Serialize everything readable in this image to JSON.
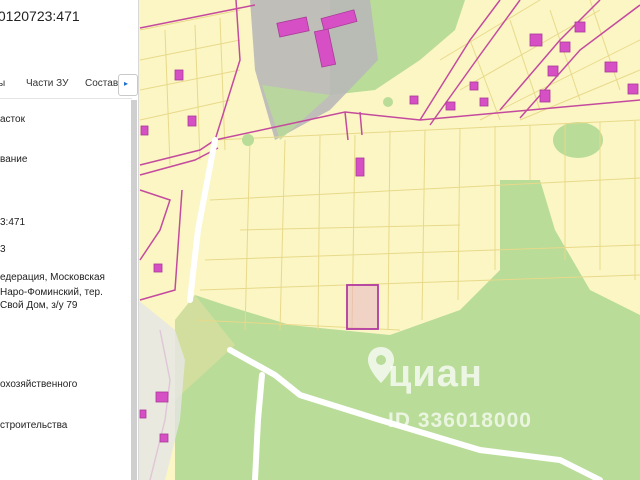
{
  "panel": {
    "cadastral_number": ":0120723:471",
    "tabs": [
      {
        "label": "ы"
      },
      {
        "label": "Части ЗУ"
      },
      {
        "label": "Состав"
      }
    ],
    "scroll_right_icon": "chevron-right-icon",
    "fields": [
      {
        "text": "асток"
      },
      {
        "text": "вание"
      },
      {
        "text": "3:471"
      },
      {
        "text": "3"
      },
      {
        "text": "едерация, Московская"
      },
      {
        "text": "Наро-Фоминский, тер."
      },
      {
        "text": "Свой Дом, з/у 79"
      },
      {
        "text": "охозяйственного"
      },
      {
        "text": "строительства"
      }
    ]
  },
  "watermark": {
    "brand": "циан",
    "id": "ID 336018000",
    "icon": "location-pin-icon"
  },
  "colors": {
    "land": "#fbf6c4",
    "forest": "#b9dc98",
    "building": "#d64fc4",
    "road_outline": "#c44a9e",
    "highlight_parcel": "#b23aa0"
  }
}
